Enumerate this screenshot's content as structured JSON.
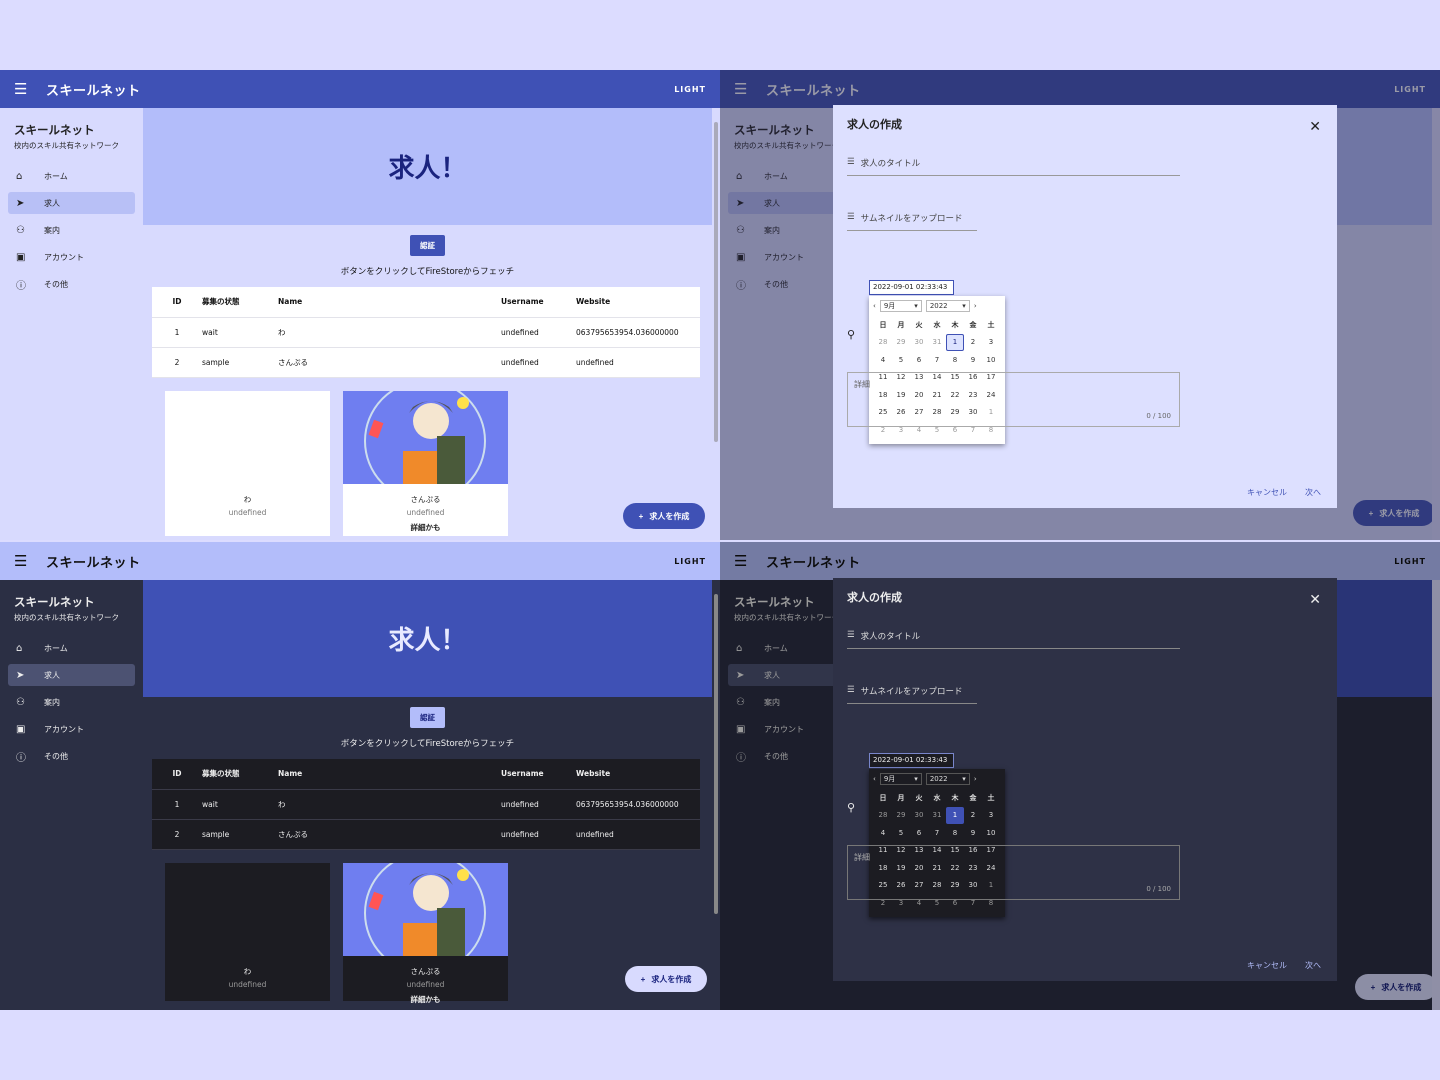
{
  "app": {
    "title": "スキールネット",
    "mode_label": "LIGHT"
  },
  "drawer": {
    "brand": "スキールネット",
    "subtitle": "校内のスキル共有ネットワーク",
    "items": [
      {
        "label": "ホーム",
        "icon": "home-icon"
      },
      {
        "label": "求人",
        "icon": "rocket-icon"
      },
      {
        "label": "案内",
        "icon": "person-walking-icon"
      },
      {
        "label": "アカウント",
        "icon": "badge-icon"
      },
      {
        "label": "その他",
        "icon": "info-icon"
      }
    ]
  },
  "page": {
    "hero": "求人！",
    "auth_button": "認証",
    "fetch_text": "ボタンをクリックしてFireStoreからフェッチ",
    "table": {
      "headers": [
        "ID",
        "募集の状態",
        "Name",
        "Username",
        "Website"
      ],
      "rows": [
        [
          "1",
          "wait",
          "わ",
          "undefined",
          "063795653954.036000000"
        ],
        [
          "2",
          "sample",
          "さんぷる",
          "undefined",
          "undefined"
        ]
      ]
    },
    "cards": [
      {
        "name": "わ",
        "desc": "undefined",
        "more": ""
      },
      {
        "name": "さんぷる",
        "desc": "undefined",
        "more": "詳細かも"
      }
    ],
    "fab_label": "求人を作成",
    "fab_icon": "plus-icon"
  },
  "dialog": {
    "title": "求人の作成",
    "job_title_field": "求人のタイトル",
    "thumbnail_field": "サムネイルをアップロード",
    "date_value": "2022-09-01 02:33:43",
    "month": "9月",
    "year": "2022",
    "weekdays": [
      "日",
      "月",
      "火",
      "水",
      "木",
      "金",
      "土"
    ],
    "days": [
      "28",
      "29",
      "30",
      "31",
      "1",
      "2",
      "3",
      "4",
      "5",
      "6",
      "7",
      "8",
      "9",
      "10",
      "11",
      "12",
      "13",
      "14",
      "15",
      "16",
      "17",
      "18",
      "19",
      "20",
      "21",
      "22",
      "23",
      "24",
      "25",
      "26",
      "27",
      "28",
      "29",
      "30",
      "1",
      "2",
      "3",
      "4",
      "5",
      "6",
      "7",
      "8"
    ],
    "selected_day": "1",
    "details_placeholder": "詳細",
    "char_count": "0 / 100",
    "cancel": "キャンセル",
    "next": "次へ"
  },
  "colors": {
    "primary": "#3f51b5",
    "primary_light": "#b3bdfa",
    "bg_light": "#d8dafe",
    "bg_dark": "#2b2f44"
  }
}
